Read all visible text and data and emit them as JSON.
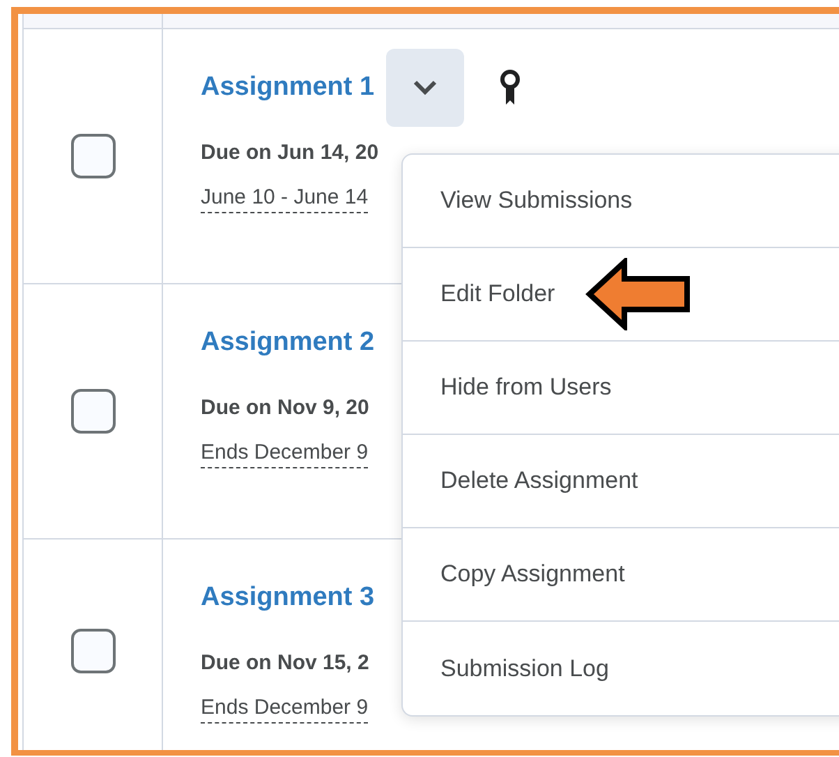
{
  "assignments": [
    {
      "title": "Assignment 1",
      "checked": false,
      "due": "Due on Jun 14, 20",
      "dates": "June 10 - June 14",
      "menu_open": true,
      "has_rubric": true
    },
    {
      "title": "Assignment 2",
      "checked": false,
      "due": "Due on Nov 9, 20",
      "dates": "Ends December 9",
      "menu_open": false,
      "has_rubric": false
    },
    {
      "title": "Assignment 3",
      "checked": false,
      "due": "Due on Nov 15, 2",
      "dates": "Ends December 9",
      "menu_open": false,
      "has_rubric": false
    }
  ],
  "menu": {
    "items": [
      {
        "label": "View Submissions",
        "highlighted": false
      },
      {
        "label": "Edit Folder",
        "highlighted": true
      },
      {
        "label": "Hide from Users",
        "highlighted": false
      },
      {
        "label": "Delete Assignment",
        "highlighted": false
      },
      {
        "label": "Copy Assignment",
        "highlighted": false
      },
      {
        "label": "Submission Log",
        "highlighted": false
      }
    ]
  }
}
